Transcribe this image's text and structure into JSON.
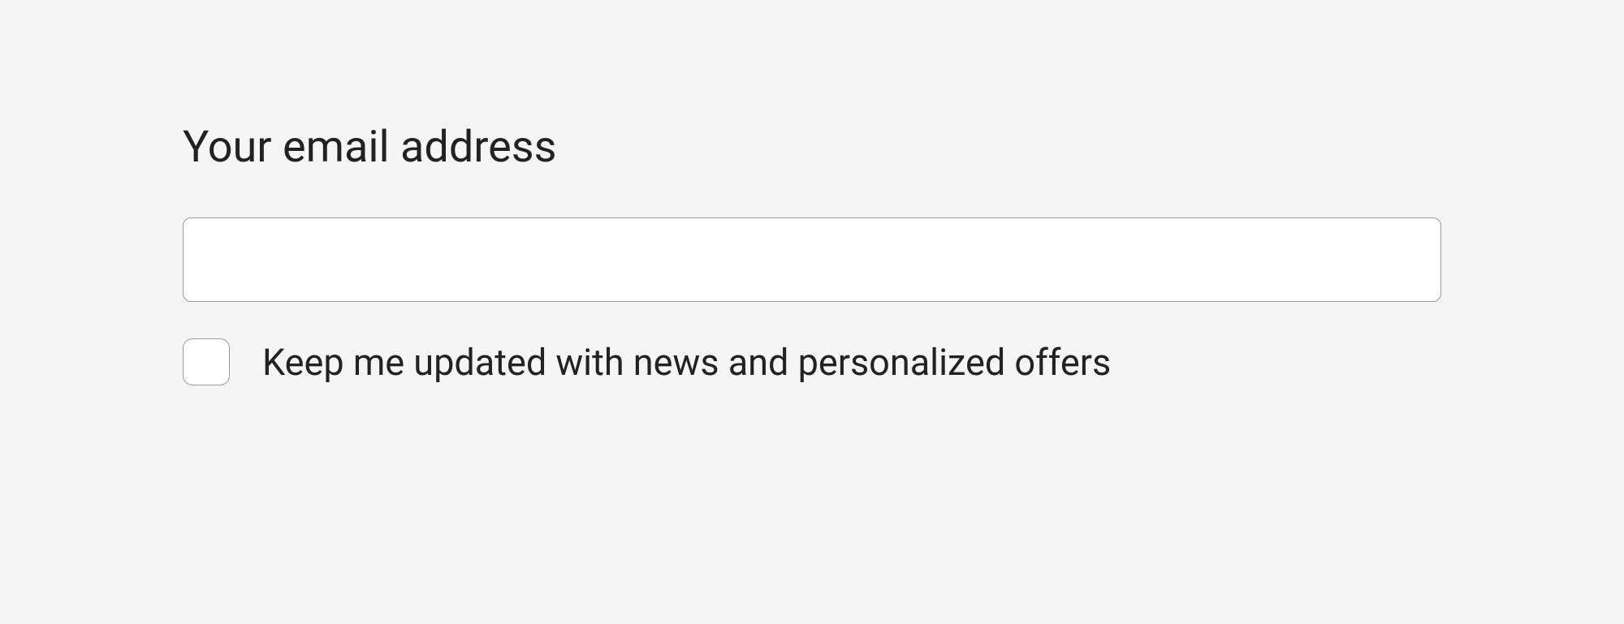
{
  "form": {
    "email_label": "Your email address",
    "email_value": "",
    "checkbox_label": "Keep me updated with news and personalized offers",
    "checkbox_checked": false
  }
}
